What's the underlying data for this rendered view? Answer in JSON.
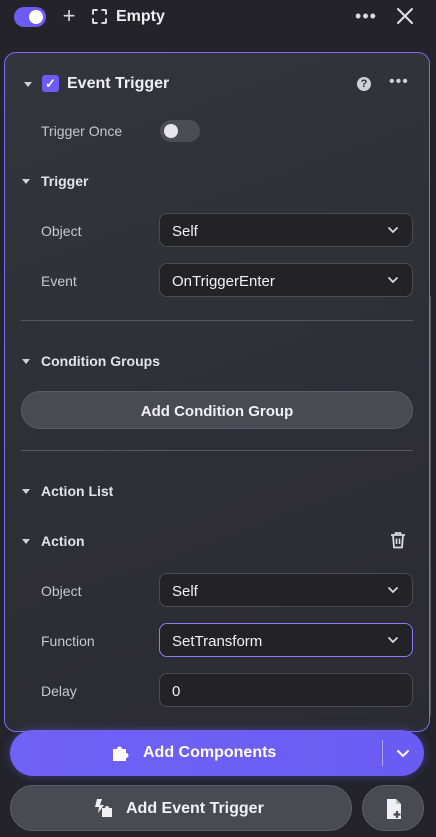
{
  "topbar": {
    "title": "Empty",
    "enabled": true,
    "more_icon": "more-horizontal-icon",
    "close_icon": "close-icon"
  },
  "component": {
    "title": "Event Trigger",
    "checked": true,
    "help_icon": "help-icon",
    "more_icon": "more-horizontal-icon",
    "trigger_once_label": "Trigger Once",
    "trigger_once_enabled": false,
    "trigger_section": {
      "label": "Trigger",
      "object_label": "Object",
      "object_value": "Self",
      "event_label": "Event",
      "event_value": "OnTriggerEnter"
    },
    "condition_groups": {
      "label": "Condition Groups",
      "add_button": "Add Condition Group"
    },
    "action_list": {
      "label": "Action List",
      "action": {
        "label": "Action",
        "delete_icon": "trash-icon",
        "object_label": "Object",
        "object_value": "Self",
        "function_label": "Function",
        "function_value": "SetTransform",
        "delay_label": "Delay",
        "delay_value": "0"
      }
    }
  },
  "footer": {
    "add_components": "Add Components",
    "add_event_trigger": "Add Event Trigger",
    "file_icon": "add-file-icon"
  },
  "colors": {
    "accent": "#6c5cf5",
    "background": "#232329",
    "panel": "#2f2f36"
  }
}
